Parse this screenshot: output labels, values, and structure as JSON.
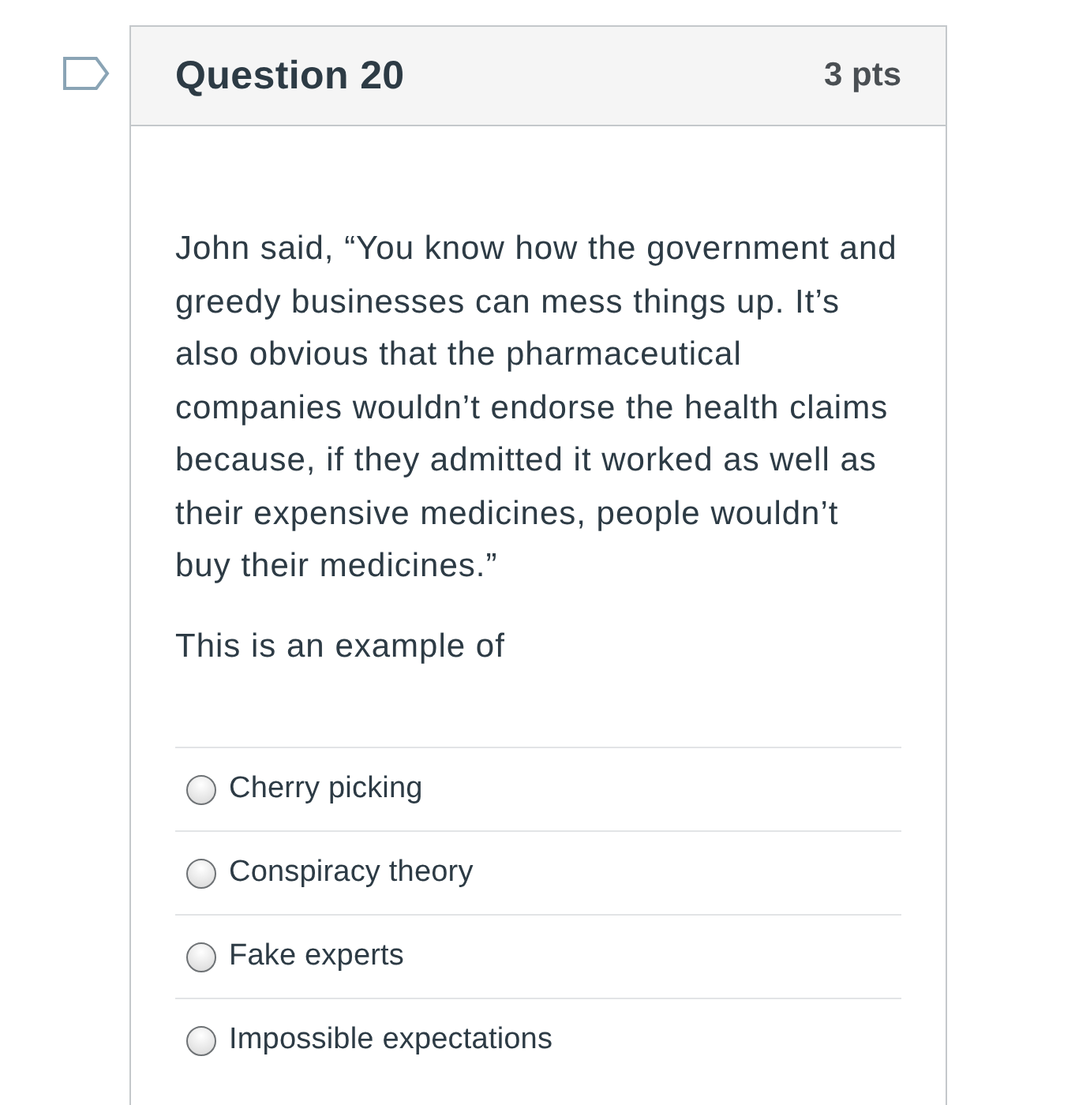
{
  "question": {
    "title": "Question 20",
    "points": "3 pts",
    "flagged": false
  },
  "prompt": [
    "John said, “You know how the government and greedy businesses can mess things up. It’s also obvious that the pharmaceutical companies wouldn’t endorse the health claims because, if they admitted it worked as well as their expensive medicines, people wouldn’t buy their medicines.”",
    "This is an example of"
  ],
  "answers": [
    {
      "label": "Cherry picking",
      "selected": false
    },
    {
      "label": "Conspiracy theory",
      "selected": false
    },
    {
      "label": "Fake experts",
      "selected": false
    },
    {
      "label": "Impossible expectations",
      "selected": false
    }
  ]
}
